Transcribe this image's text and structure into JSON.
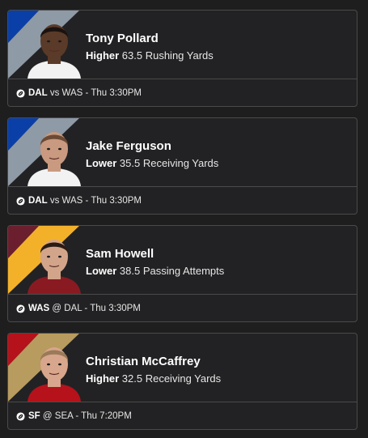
{
  "picks": [
    {
      "player": "Tony Pollard",
      "direction": "Higher",
      "line": "63.5 Rushing Yards",
      "team": "DAL",
      "matchup_rest": "vs WAS - Thu 3:30PM",
      "stripe_colors": [
        "#0b3fa8",
        "#8e9aa6"
      ],
      "skin": "#5a3a28",
      "hair": "#1a1210",
      "jersey": "#f2f2f2",
      "icon": "football-icon"
    },
    {
      "player": "Jake Ferguson",
      "direction": "Lower",
      "line": "35.5 Receiving Yards",
      "team": "DAL",
      "matchup_rest": "vs WAS - Thu 3:30PM",
      "stripe_colors": [
        "#0b3fa8",
        "#8e9aa6"
      ],
      "skin": "#c99a80",
      "hair": "#6b4a34",
      "jersey": "#f2f2f2",
      "icon": "football-icon"
    },
    {
      "player": "Sam Howell",
      "direction": "Lower",
      "line": "38.5 Passing Attempts",
      "team": "WAS",
      "matchup_rest": "@ DAL - Thu 3:30PM",
      "stripe_colors": [
        "#6b1f2e",
        "#f3b12a"
      ],
      "skin": "#d2a58a",
      "hair": "#2a1c14",
      "jersey": "#8a1a22",
      "icon": "football-icon"
    },
    {
      "player": "Christian McCaffrey",
      "direction": "Higher",
      "line": "32.5 Receiving Yards",
      "team": "SF",
      "matchup_rest": "@ SEA - Thu 7:20PM",
      "stripe_colors": [
        "#b5121b",
        "#b89b5e"
      ],
      "skin": "#d8a68c",
      "hair": "#9a7a58",
      "jersey": "#b5121b",
      "icon": "football-icon"
    }
  ]
}
